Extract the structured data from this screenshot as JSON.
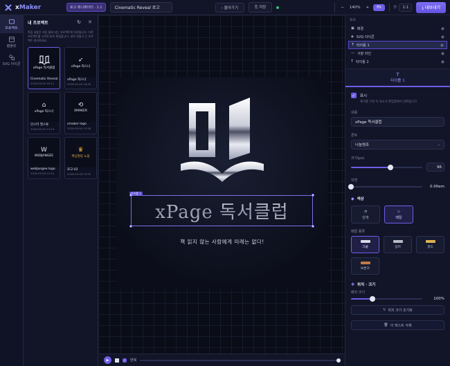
{
  "app": {
    "name_prefix": "x",
    "name_suffix": "Maker",
    "mode_badge": "로고 애니메이터 · 1:1",
    "doc_title": "Cinematic Reveal 로고"
  },
  "toolbar": {
    "back_label": "돌아가기",
    "save_label": "저장",
    "zoom_out": "−",
    "zoom_value": "140%",
    "zoom_in": "+",
    "fit_label": "Fit",
    "ratio_label": "1:1",
    "export_label": "내보내기"
  },
  "rail": [
    {
      "label": "프로젝트",
      "icon": "folder-icon"
    },
    {
      "label": "템플릿",
      "icon": "template-icon"
    },
    {
      "label": "SVG 아이콘",
      "icon": "shapes-icon"
    }
  ],
  "projects": {
    "title": "내 프로젝트",
    "description": "편집 내용은 자동 몰래 되는 프로젝트에 저장됩니다. 다른 프로젝트를 고르면 바로 편집합니다. 새로 만들기 는 프로젝트 관리하세요.",
    "items": [
      {
        "name": "Cinematic Reveal ...",
        "date": "2026-09-09 19:11",
        "thumb_text": "xPage 독서클럽",
        "icon": "book-icon"
      },
      {
        "name": "xPage 픽스너",
        "date": "2026-09-09 16:49",
        "thumb_text": "xPage 픽스너",
        "icon": "bird-icon"
      },
      {
        "name": "인스터 필스튜",
        "date": "2026-09-09 14:24",
        "thumb_text": "xPage 픽스너",
        "icon": "tag-icon"
      },
      {
        "name": "xmaker logo",
        "date": "2026-09-09 13:58",
        "thumb_text": "XMAKER",
        "icon": "xmaker-icon"
      },
      {
        "name": "webjangee logo",
        "date": "2026-09-09 23:24",
        "thumb_text": "WEBJANGEE",
        "icon": "w-icon"
      },
      {
        "name": "로고-02",
        "date": "2026-09-09 23:53",
        "thumb_text": "핵심필링 노봉",
        "icon": "crown-icon"
      }
    ]
  },
  "canvas": {
    "selection_tag": "타이틀 1",
    "brand_text": "xPage 독서클럽",
    "slogan": "책 읽지 않는 사람에게 미래는 없다!",
    "loop_label": "반복",
    "progress": 1.0
  },
  "layers": {
    "title": "요소",
    "items": [
      {
        "label": "배경",
        "icon": "image-icon",
        "active": false
      },
      {
        "label": "SVG 아이콘",
        "icon": "shapes-icon",
        "active": false
      },
      {
        "label": "타이틀 1",
        "icon": "text-icon",
        "active": true
      },
      {
        "label": "구분 라인",
        "icon": "line-icon",
        "active": false
      },
      {
        "label": "타이틀 2",
        "icon": "text-icon",
        "active": false
      }
    ]
  },
  "props": {
    "tab_label": "타이틀 1",
    "show_label": "표시",
    "show_hint": "체크를 끄면 이 요소가 편집창에서 감춰집니다.",
    "content_label": "내용",
    "content_value": "xPage 독서클럽",
    "font_label": "폰트",
    "font_value": "나눔명조",
    "size_label": "크기(px)",
    "size_value": "96",
    "size_fraction": 0.55,
    "delay_label": "지연",
    "delay_value": "0.00em",
    "delay_fraction": 0.0,
    "color_title": "색상",
    "color_modes": [
      "단색",
      "메탈"
    ],
    "metal_type_label": "메탈 종류",
    "metals": [
      {
        "label": "크롬",
        "color": "#d8dbe6"
      },
      {
        "label": "실버",
        "color": "#b9bdc8"
      },
      {
        "label": "골드",
        "color": "#e0b352"
      },
      {
        "label": "브론즈",
        "color": "#c07a45"
      }
    ],
    "position_title": "위치 · 크기",
    "scale_label": "배치 크기",
    "scale_value": "100%",
    "scale_fraction": 0.3,
    "reset_label": "위치 크기 초기화",
    "delete_label": "이 텍스트 삭제"
  },
  "colors": {
    "accent": "#6d5ee8",
    "background": "#0d1020",
    "panel": "#121528"
  }
}
